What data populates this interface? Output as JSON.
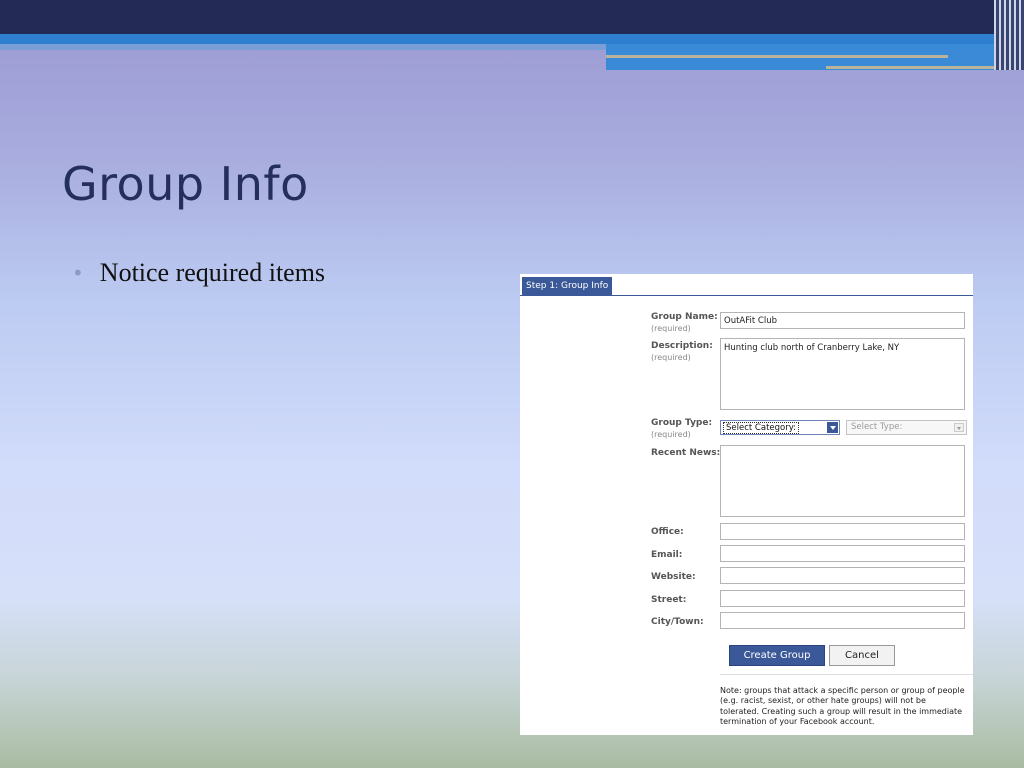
{
  "slide": {
    "title": "Group Info",
    "bullets": [
      "Notice required items"
    ]
  },
  "form": {
    "tab_label": "Step 1: Group Info",
    "required_text": "(required)",
    "fields": {
      "group_name": {
        "label": "Group Name:",
        "value": "OutAFit Club"
      },
      "description": {
        "label": "Description:",
        "value": "Hunting club north of Cranberry Lake, NY"
      },
      "group_type": {
        "label": "Group Type:",
        "category": "Select Category:",
        "type": "Select Type:"
      },
      "recent_news": {
        "label": "Recent News:",
        "value": ""
      },
      "office": {
        "label": "Office:",
        "value": ""
      },
      "email": {
        "label": "Email:",
        "value": ""
      },
      "website": {
        "label": "Website:",
        "value": ""
      },
      "street": {
        "label": "Street:",
        "value": ""
      },
      "city": {
        "label": "City/Town:",
        "value": ""
      }
    },
    "buttons": {
      "create": "Create Group",
      "cancel": "Cancel"
    },
    "note": "Note: groups that attack a specific person or group of people (e.g. racist, sexist, or other hate groups) will not be tolerated. Creating such a group will result in the immediate termination of your Facebook account."
  },
  "colors": {
    "title": "#252f5c",
    "top_bar": "#222a55",
    "accent_blue": "#2f7fd0",
    "facebook_blue": "#3b5998"
  }
}
